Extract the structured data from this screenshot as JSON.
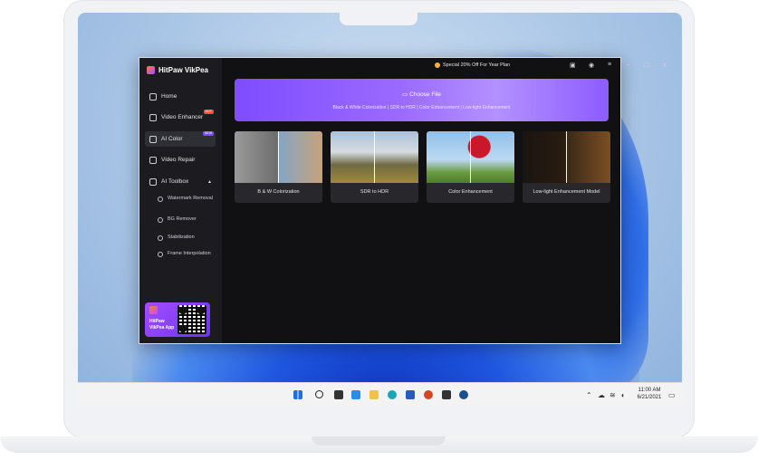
{
  "app": {
    "title": "HitPaw VikPea",
    "promo_banner": "Special 20% Off For Year Plan"
  },
  "sidebar": {
    "items": [
      {
        "label": "Home"
      },
      {
        "label": "Video Enhancer",
        "badge": "HOT"
      },
      {
        "label": "AI Color",
        "badge": "NEW",
        "active": true
      },
      {
        "label": "Video Repair"
      },
      {
        "label": "AI Toolbox"
      }
    ],
    "toolbox_items": [
      {
        "label": "Watermark Removal"
      },
      {
        "label": "BG Remover"
      },
      {
        "label": "Stabilization"
      },
      {
        "label": "Frame Interpolation"
      }
    ],
    "app_promo": {
      "line1": "HitPaw",
      "line2": "VikPea App"
    }
  },
  "main": {
    "choose_file": "Choose File",
    "features_line": "Black & White Colorization | SDR to HDR | Color Enhancement | Low-light Enhancement",
    "cards": [
      {
        "label": "B & W Colorization"
      },
      {
        "label": "SDR to HDR"
      },
      {
        "label": "Color Enhancement"
      },
      {
        "label": "Low-light Enhancement Model"
      }
    ]
  },
  "taskbar": {
    "time": "11:00 AM",
    "date": "6/21/2021"
  },
  "colors": {
    "accent": "#8a5cff",
    "app_bg": "#111114",
    "sidebar_bg": "#1b1b20"
  }
}
